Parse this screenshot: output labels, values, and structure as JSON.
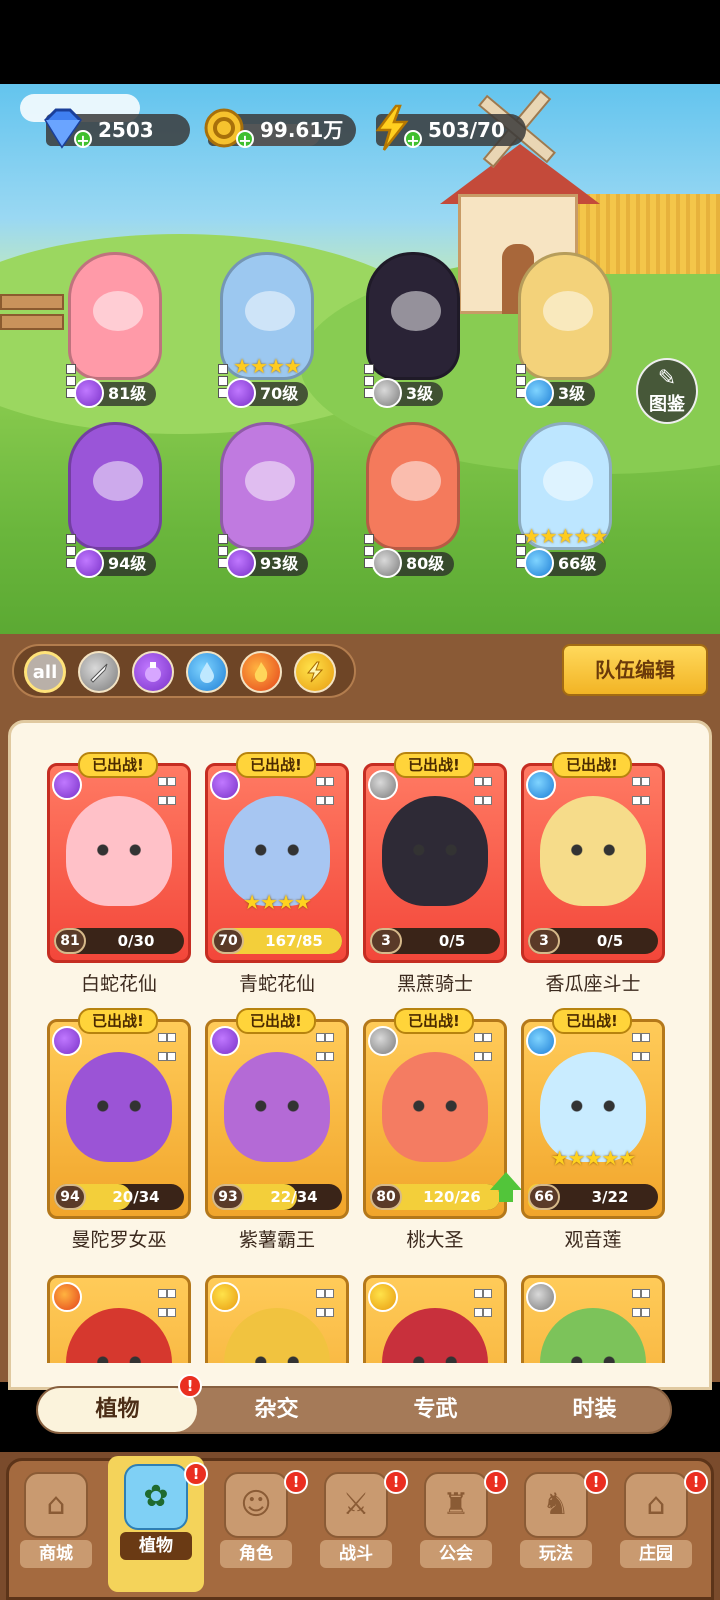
{
  "resources": {
    "diamonds": "2503",
    "coins": "99.61万",
    "energy": "503/70"
  },
  "codex_label": "图鉴",
  "team": [
    {
      "level": "81级",
      "type": "poison",
      "stars": 0,
      "color": "#ff9aa8"
    },
    {
      "level": "70级",
      "type": "poison",
      "stars": 4,
      "color": "#9cc8f0"
    },
    {
      "level": "3级",
      "type": "sword",
      "stars": 0,
      "color": "#2a2336"
    },
    {
      "level": "3级",
      "type": "water",
      "stars": 0,
      "color": "#f3d27a"
    },
    {
      "level": "94级",
      "type": "poison",
      "stars": 0,
      "color": "#9a55d8"
    },
    {
      "level": "93级",
      "type": "poison",
      "stars": 0,
      "color": "#c07ae0"
    },
    {
      "level": "80级",
      "type": "sword",
      "stars": 0,
      "color": "#f47a5c"
    },
    {
      "level": "66级",
      "type": "water",
      "stars": 5,
      "color": "#bde6ff"
    }
  ],
  "filters": {
    "all_label": "all",
    "icons": [
      "sword-icon",
      "poison-icon",
      "water-icon",
      "fire-icon",
      "bolt-icon"
    ]
  },
  "team_edit_label": "队伍编辑",
  "deployed_label": "已出战!",
  "cards": [
    {
      "name": "白蛇花仙",
      "level": "81",
      "progress": "0/30",
      "fill": 0.0,
      "type": "poison",
      "style": "red",
      "stars": 0,
      "deployed": true,
      "art": "#ffc1c8"
    },
    {
      "name": "青蛇花仙",
      "level": "70",
      "progress": "167/85",
      "fill": 1.0,
      "type": "poison",
      "style": "red",
      "stars": 4,
      "deployed": true,
      "art": "#a7c6f2"
    },
    {
      "name": "黑蔗骑士",
      "level": "3",
      "progress": "0/5",
      "fill": 0.0,
      "type": "sword",
      "style": "red",
      "stars": 0,
      "deployed": true,
      "art": "#2e2a36"
    },
    {
      "name": "香瓜座斗士",
      "level": "3",
      "progress": "0/5",
      "fill": 0.0,
      "type": "water",
      "style": "red",
      "stars": 0,
      "deployed": true,
      "art": "#f6dc8a"
    },
    {
      "name": "曼陀罗女巫",
      "level": "94",
      "progress": "20/34",
      "fill": 0.59,
      "type": "poison",
      "style": "gold",
      "stars": 0,
      "deployed": true,
      "art": "#9b54d6"
    },
    {
      "name": "紫薯霸王",
      "level": "93",
      "progress": "22/34",
      "fill": 0.65,
      "type": "poison",
      "style": "gold",
      "stars": 0,
      "deployed": true,
      "art": "#b46ad6"
    },
    {
      "name": "桃大圣",
      "level": "80",
      "progress": "120/26",
      "fill": 1.0,
      "type": "sword",
      "style": "gold",
      "stars": 0,
      "deployed": true,
      "art": "#f47c62",
      "upgrade": true
    },
    {
      "name": "观音莲",
      "level": "66",
      "progress": "3/22",
      "fill": 0.14,
      "type": "water",
      "style": "gold",
      "stars": 5,
      "deployed": true,
      "art": "#c9ecff"
    },
    {
      "name": "",
      "type": "fire",
      "style": "gold",
      "art": "#d6382e"
    },
    {
      "name": "",
      "type": "bolt",
      "style": "gold",
      "art": "#f1c33f"
    },
    {
      "name": "",
      "type": "bolt",
      "style": "gold",
      "art": "#c8303c"
    },
    {
      "name": "",
      "type": "sword",
      "style": "gold",
      "art": "#7cc35a"
    }
  ],
  "subtabs": [
    "植物",
    "杂交",
    "专武",
    "时装"
  ],
  "subtab_badge": "!",
  "nav": [
    {
      "label": "商城",
      "icon": "shop-icon",
      "badge": false
    },
    {
      "label": "植物",
      "icon": "plant-icon",
      "badge": true
    },
    {
      "label": "角色",
      "icon": "character-icon",
      "badge": true
    },
    {
      "label": "战斗",
      "icon": "battle-icon",
      "badge": true
    },
    {
      "label": "公会",
      "icon": "guild-icon",
      "badge": true
    },
    {
      "label": "玩法",
      "icon": "gameplay-icon",
      "badge": true
    },
    {
      "label": "庄园",
      "icon": "manor-icon",
      "badge": true
    }
  ],
  "nav_badge": "!",
  "colors": {
    "accent": "#f2b425",
    "panel_brown": "#8a5a36",
    "poison": "#7a32c8",
    "water": "#1f7fd6",
    "fire": "#e4431b",
    "bolt": "#e89b10",
    "sword": "#7b7b7b"
  }
}
